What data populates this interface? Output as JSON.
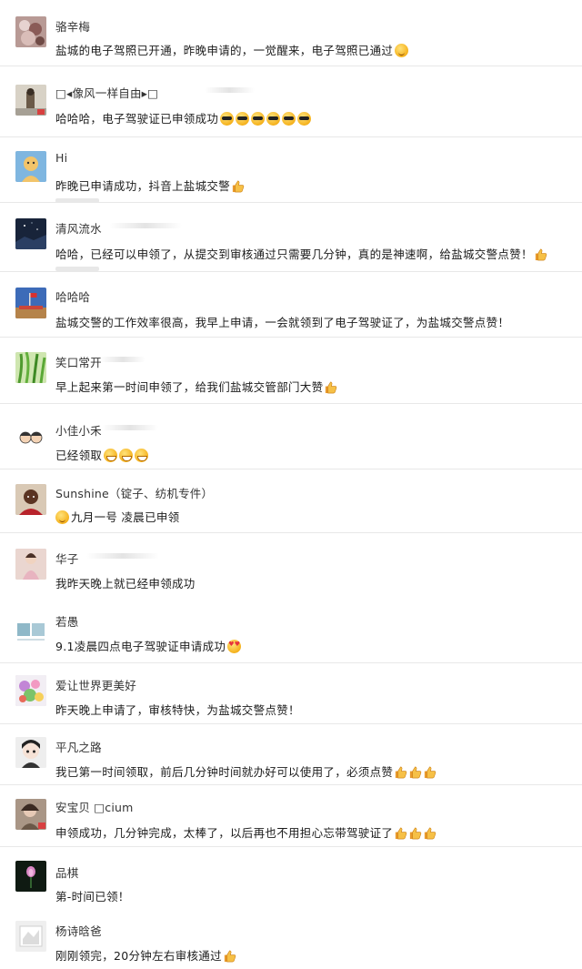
{
  "comments": [
    {
      "name": "骆辛梅",
      "text": "盐城的电子驾照已开通，昨晚申请的，一觉醒来，电子驾照已通过",
      "emojis": [
        "smile"
      ],
      "thumbs": 0
    },
    {
      "name": "□◂像风一样自由▸□",
      "text": "哈哈哈，电子驾驶证已申领成功",
      "emojis": [
        "cool",
        "cool",
        "cool",
        "cool",
        "cool",
        "cool"
      ],
      "thumbs": 0
    },
    {
      "name": "Hi",
      "text": "昨晚已申请成功，抖音上盐城交警",
      "emojis": [],
      "thumbs": 1
    },
    {
      "name": "清风流水",
      "text": "哈哈，已经可以申领了，从提交到审核通过只需要几分钟，真的是神速啊，给盐城交警点赞！",
      "emojis": [],
      "thumbs": 1
    },
    {
      "name": "哈哈哈",
      "text": "盐城交警的工作效率很高，我早上申请，一会就领到了电子驾驶证了，为盐城交警点赞！",
      "emojis": [],
      "thumbs": 0
    },
    {
      "name": "笑口常开",
      "text": "早上起来第一时间申领了，给我们盐城交管部门大赞",
      "emojis": [],
      "thumbs": 1
    },
    {
      "name": "小佳小禾",
      "text": "已经领取",
      "emojis": [
        "grin",
        "grin",
        "grin"
      ],
      "thumbs": 0
    },
    {
      "name": "Sunshine（锭子、纺机专件）",
      "text": "九月一号 凌晨已申领",
      "emojis_before": [
        "smile"
      ],
      "emojis": [],
      "thumbs": 0
    },
    {
      "name": "华子",
      "text": "我昨天晚上就已经申领成功",
      "emojis": [],
      "thumbs": 0
    },
    {
      "name": "若愚",
      "text": "9.1凌晨四点电子驾驶证申请成功",
      "emojis": [
        "heart-eyes"
      ],
      "thumbs": 0
    },
    {
      "name": "爱让世界更美好",
      "text": "昨天晚上申请了，审核特快，为盐城交警点赞！",
      "emojis": [],
      "thumbs": 0
    },
    {
      "name": "平凡之路",
      "text": "我已第一时间领取，前后几分钟时间就办好可以使用了，必须点赞",
      "emojis": [],
      "thumbs": 3
    },
    {
      "name": "安宝贝 □cium",
      "text": "申领成功，几分钟完成，太棒了，以后再也不用担心忘带驾驶证了",
      "emojis": [],
      "thumbs": 3
    },
    {
      "name": "品棋",
      "text": "第-时间已领！",
      "emojis": [],
      "thumbs": 0
    },
    {
      "name": "杨诗晗爸",
      "text": "刚刚领完，20分钟左右审核通过",
      "emojis": [],
      "thumbs": 1
    }
  ],
  "avatar_colors": [
    "#9b6f63",
    "#8b8478",
    "#6fa7d8",
    "#1c2a44",
    "#2a4a8a",
    "#5fa845",
    "#e6e6e6",
    "#6a3a2a",
    "#c9a8a0",
    "#8fb3c8",
    "#c6a0d8",
    "#cfcfcf",
    "#7a6a5a",
    "#1a2a1a",
    "#e8e8e8"
  ]
}
